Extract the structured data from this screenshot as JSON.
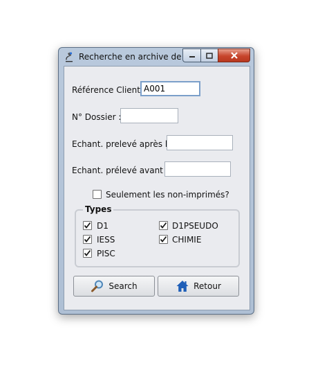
{
  "window": {
    "title": "Recherche en archive de ...",
    "controls": [
      "minimize-icon",
      "maximize-icon",
      "close-icon"
    ]
  },
  "form": {
    "reference_client": {
      "label": "Référence Client :",
      "value": "A001"
    },
    "dossier": {
      "label": "N° Dossier :",
      "value": ""
    },
    "preleve_apres": {
      "label": "Echant. prelevé après le",
      "value": ""
    },
    "preleve_avant": {
      "label": "Echant. prélevé avant le",
      "value": ""
    },
    "non_imprimes": {
      "label": "Seulement les non-imprimés?",
      "checked": false
    }
  },
  "types": {
    "title": "Types",
    "items": [
      {
        "label": "D1",
        "checked": true
      },
      {
        "label": "D1PSEUDO",
        "checked": true
      },
      {
        "label": "IESS",
        "checked": true
      },
      {
        "label": "CHIMIE",
        "checked": true
      },
      {
        "label": "PISC",
        "checked": true
      }
    ]
  },
  "buttons": {
    "search": {
      "label": "Search",
      "icon": "magnifier-icon"
    },
    "retour": {
      "label": "Retour",
      "icon": "home-icon"
    }
  }
}
